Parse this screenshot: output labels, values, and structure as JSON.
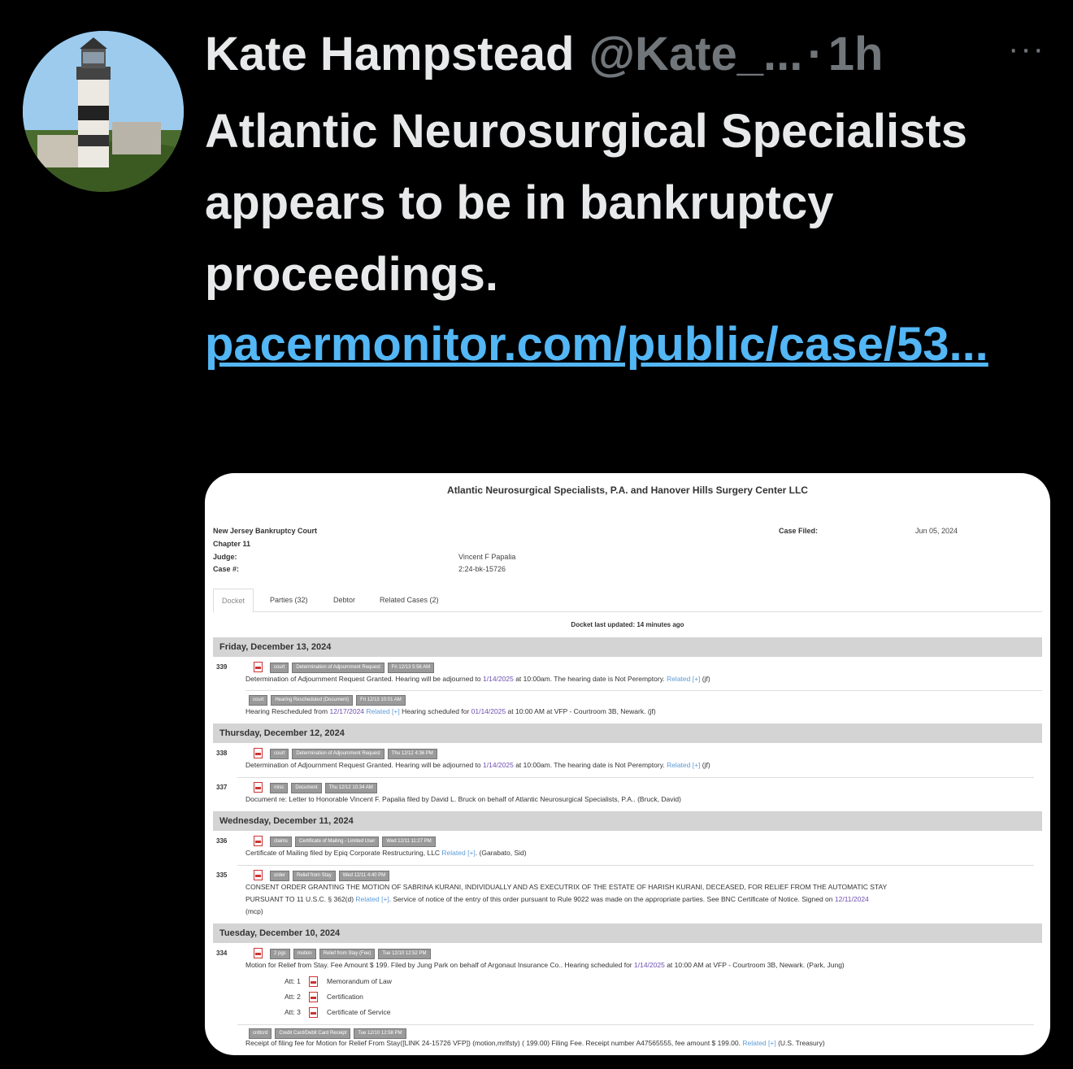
{
  "tweet": {
    "name": "Kate Hampstead",
    "handle": "@Kate_...",
    "dot": "·",
    "time": "1h",
    "more": "···",
    "text": "Atlantic Neurosurgical Specialists appears to be in bankruptcy proceedings.",
    "link": "pacermonitor.com/public/case/53..."
  },
  "card": {
    "title": "Atlantic Neurosurgical Specialists, P.A. and Hanover Hills Surgery Center LLC",
    "court": "New Jersey Bankruptcy Court",
    "chapter": "Chapter 11",
    "judge_label": "Judge:",
    "judge": "Vincent F Papalia",
    "case_label": "Case #:",
    "case": "2:24-bk-15726",
    "filed_label": "Case Filed:",
    "filed": "Jun 05, 2024",
    "tabs": [
      "Docket",
      "Parties (32)",
      "Debtor",
      "Related Cases (2)"
    ],
    "updated": "Docket last updated: 14 minutes ago",
    "days": [
      "Friday, December 13, 2024",
      "Thursday, December 12, 2024",
      "Wednesday, December 11, 2024",
      "Tuesday, December 10, 2024"
    ],
    "entries": [
      {
        "num": "339",
        "tags": [
          "court",
          "Determination of Adjournment Request",
          "Fri 12/13 5:56 AM"
        ],
        "pre": "Determination of Adjournment Request Granted. Hearing will be adjourned to ",
        "date": "1/14/2025",
        "post": " at 10:00am. The hearing date is Not Peremptory. ",
        "rel": "Related [+]",
        "end": " (jf)"
      },
      {
        "num": "",
        "tags": [
          "court",
          "Hearing Rescheduled (Document)",
          "Fri 12/13 10:01 AM"
        ],
        "pre": "Hearing Rescheduled from ",
        "date": "12/17/2024",
        "mid": " Related [+]",
        "post": " Hearing scheduled for ",
        "date2": "01/14/2025",
        "end": " at 10:00 AM at VFP - Courtroom 3B, Newark. (jf)"
      },
      {
        "num": "338",
        "tags": [
          "court",
          "Determination of Adjournment Request",
          "Thu 12/12 4:36 PM"
        ],
        "pre": "Determination of Adjournment Request Granted. Hearing will be adjourned to ",
        "date": "1/14/2025",
        "post": " at 10:00am. The hearing date is Not Peremptory. ",
        "rel": "Related [+]",
        "end": " (jf)"
      },
      {
        "num": "337",
        "tags": [
          "misc",
          "Document",
          "Thu 12/12 10:34 AM"
        ],
        "text": "Document re: Letter to Honorable Vincent F. Papalia filed by David L. Bruck on behalf of Atlantic Neurosurgical Specialists, P.A.. (Bruck, David)"
      },
      {
        "num": "336",
        "tags": [
          "claims",
          "Certificate of Mailing - Limited User",
          "Wed 12/11 11:27 PM"
        ],
        "pre": "Certificate of Mailing filed by Epiq Corporate Restructuring, LLC ",
        "rel": "Related [+]",
        "end": ". (Garabato, Sid)"
      },
      {
        "num": "335",
        "tags": [
          "order",
          "Relief from Stay",
          "Wed 12/11 4:40 PM"
        ],
        "line1": "CONSENT ORDER GRANTING THE MOTION OF SABRINA KURANI, INDIVIDUALLY AND AS EXECUTRIX OF THE ESTATE OF HARISH KURANI, DECEASED, FOR RELIEF FROM THE AUTOMATIC STAY",
        "line2pre": "PURSUANT TO 11 U.S.C. § 362(d) ",
        "rel": "Related [+]",
        "line2post": ". Service of notice of the entry of this order pursuant to Rule 9022 was made on the appropriate parties. See BNC Certificate of Notice. Signed on ",
        "date": "12/11/2024",
        "line3": "(mcp)"
      },
      {
        "num": "334",
        "tags": [
          "2 pgs",
          "motion",
          "Relief from Stay (Fee)",
          "Tue 12/10 12:52 PM"
        ],
        "pre": "Motion for Relief from Stay. Fee Amount $ 199. Filed by Jung Park on behalf of Argonaut Insurance Co.. Hearing scheduled for ",
        "date": "1/14/2025",
        "end": " at 10:00 AM at VFP - Courtroom 3B, Newark. (Park, Jung)",
        "atts": [
          {
            "label": "Att: 1",
            "name": "Memorandum of Law"
          },
          {
            "label": "Att: 2",
            "name": "Certification"
          },
          {
            "label": "Att: 3",
            "name": "Certificate of Service"
          }
        ]
      },
      {
        "num": "",
        "tags": [
          "crdtcrd",
          "Credit Card/Debit Card Receipt",
          "Tue 12/10 12:58 PM"
        ],
        "pre": "Receipt of filing fee for Motion for Relief From Stay([LINK 24-15726 VFP]) (motion,mrlfsty) ( 199.00) Filing Fee. Receipt number A47565555, fee amount $ 199.00. ",
        "rel": "Related [+]",
        "end": " (U.S. Treasury)"
      }
    ]
  }
}
